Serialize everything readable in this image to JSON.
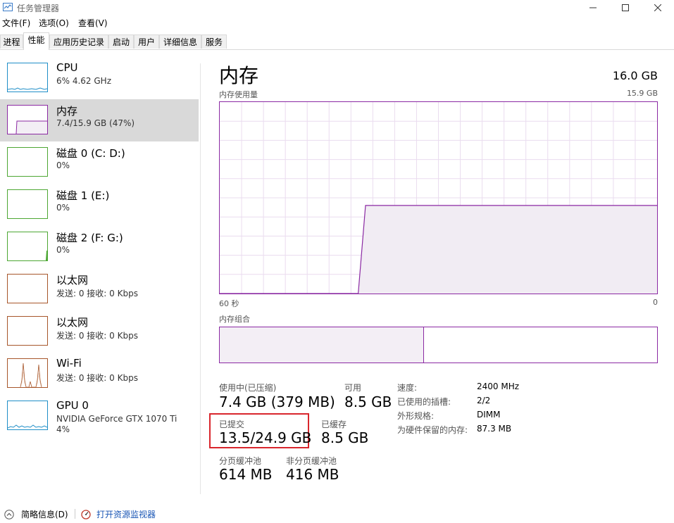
{
  "window": {
    "title": "任务管理器"
  },
  "menu": [
    "文件(F)",
    "选项(O)",
    "查看(V)"
  ],
  "tabs": [
    "进程",
    "性能",
    "应用历史记录",
    "启动",
    "用户",
    "详细信息",
    "服务"
  ],
  "active_tab": 1,
  "resources": [
    {
      "name": "CPU",
      "sub": "6% 4.62 GHz",
      "color": "#1f8ec7"
    },
    {
      "name": "内存",
      "sub": "7.4/15.9 GB (47%)",
      "color": "#8b29a3"
    },
    {
      "name": "磁盘 0 (C: D:)",
      "sub": "0%",
      "color": "#4da733"
    },
    {
      "name": "磁盘 1 (E:)",
      "sub": "0%",
      "color": "#4da733"
    },
    {
      "name": "磁盘 2 (F: G:)",
      "sub": "0%",
      "color": "#4da733"
    },
    {
      "name": "以太网",
      "sub": "发送: 0 接收: 0 Kbps",
      "color": "#a7562a"
    },
    {
      "name": "以太网",
      "sub": "发送: 0 接收: 0 Kbps",
      "color": "#a7562a"
    },
    {
      "name": "Wi-Fi",
      "sub": "发送: 0 接收: 0 Kbps",
      "color": "#a7562a"
    },
    {
      "name": "GPU 0",
      "sub": "NVIDIA GeForce GTX 1070 Ti",
      "sub2": "4%",
      "color": "#1f8ec7"
    }
  ],
  "detail": {
    "title": "内存",
    "total": "16.0 GB",
    "usage_label": "内存使用量",
    "usage_max": "15.9 GB",
    "time_left": "60 秒",
    "time_right": "0",
    "composition_label": "内存组合",
    "in_use_label": "使用中(已压缩)",
    "in_use_value": "7.4 GB (379 MB)",
    "available_label": "可用",
    "available_value": "8.5 GB",
    "committed_label": "已提交",
    "committed_value": "13.5/24.9 GB",
    "cached_label": "已缓存",
    "cached_value": "8.5 GB",
    "paged_label": "分页缓冲池",
    "paged_value": "614 MB",
    "nonpaged_label": "非分页缓冲池",
    "nonpaged_value": "416 MB",
    "specs": [
      {
        "key": "速度:",
        "val": "2400 MHz"
      },
      {
        "key": "已使用的插槽:",
        "val": "2/2"
      },
      {
        "key": "外形规格:",
        "val": "DIMM"
      },
      {
        "key": "为硬件保留的内存:",
        "val": "87.3 MB"
      }
    ],
    "usage_series": [
      0,
      0,
      0,
      0,
      0,
      0,
      0,
      0,
      0,
      0,
      0,
      0,
      0,
      0,
      0,
      0,
      0,
      0,
      0,
      0,
      0.46,
      0.46,
      0.46,
      0.46,
      0.46,
      0.46,
      0.46,
      0.46,
      0.46,
      0.46,
      0.46,
      0.46,
      0.46,
      0.46,
      0.46,
      0.46,
      0.46,
      0.46,
      0.46,
      0.46,
      0.46,
      0.46,
      0.46,
      0.46,
      0.46,
      0.46,
      0.46,
      0.46,
      0.46,
      0.46,
      0.46,
      0.46,
      0.46,
      0.46,
      0.46,
      0.46,
      0.46,
      0.46,
      0.46,
      0.46,
      0.46
    ],
    "composition_fraction": 0.467
  },
  "bottom": {
    "summary": "简略信息(D)",
    "monitor": "打开资源监视器"
  }
}
